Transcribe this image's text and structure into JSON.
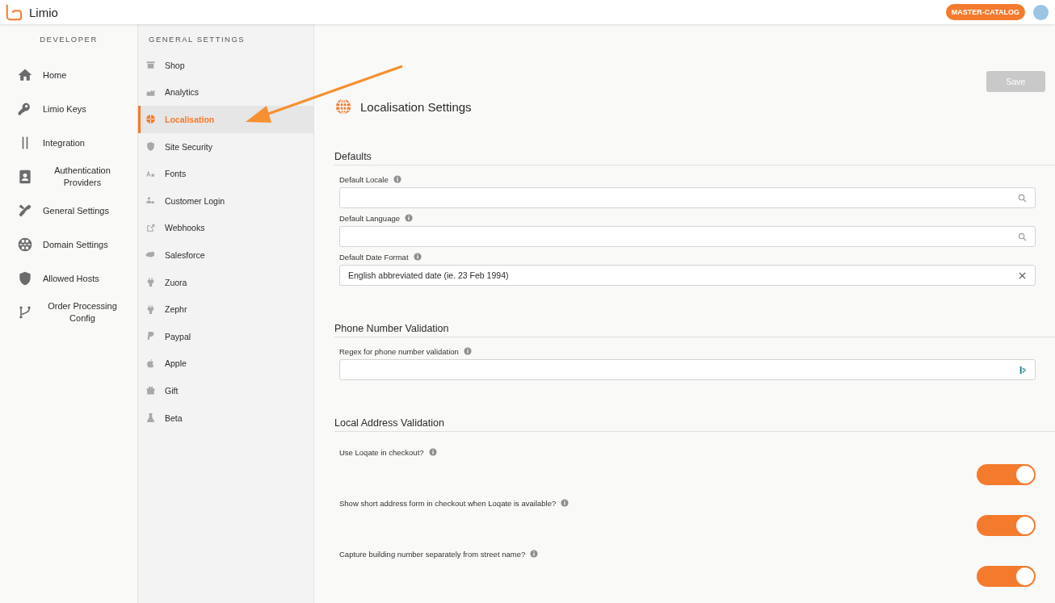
{
  "header": {
    "brand": "Limio",
    "badge": "MASTER-CATALOG"
  },
  "developer_nav": {
    "title": "DEVELOPER",
    "items": [
      {
        "label": "Home"
      },
      {
        "label": "Limio Keys"
      },
      {
        "label": "Integration"
      },
      {
        "label": "Authentication Providers"
      },
      {
        "label": "General Settings"
      },
      {
        "label": "Domain Settings"
      },
      {
        "label": "Allowed Hosts"
      },
      {
        "label": "Order Processing Config"
      }
    ]
  },
  "settings_nav": {
    "title": "GENERAL SETTINGS",
    "items": [
      {
        "label": "Shop",
        "selected": false
      },
      {
        "label": "Analytics",
        "selected": false
      },
      {
        "label": "Localisation",
        "selected": true
      },
      {
        "label": "Site Security",
        "selected": false
      },
      {
        "label": "Fonts",
        "selected": false
      },
      {
        "label": "Customer Login",
        "selected": false
      },
      {
        "label": "Webhooks",
        "selected": false
      },
      {
        "label": "Salesforce",
        "selected": false
      },
      {
        "label": "Zuora",
        "selected": false
      },
      {
        "label": "Zephr",
        "selected": false
      },
      {
        "label": "Paypal",
        "selected": false
      },
      {
        "label": "Apple",
        "selected": false
      },
      {
        "label": "Gift",
        "selected": false
      },
      {
        "label": "Beta",
        "selected": false
      }
    ]
  },
  "save_button": {
    "label": "Save",
    "disabled": true
  },
  "page_title": "Localisation Settings",
  "sections": [
    {
      "title": "Defaults",
      "fields": [
        {
          "kind": "search",
          "label": "Default Locale"
        },
        {
          "kind": "search",
          "label": "Default Language"
        },
        {
          "kind": "clearable",
          "label": "Default Date Format",
          "value": "English abbreviated date (ie. 23 Feb 1994)"
        }
      ]
    },
    {
      "title": "Phone Number Validation",
      "fields": [
        {
          "kind": "text",
          "label": "Regex for phone number validation"
        }
      ]
    },
    {
      "title": "Local Address Validation",
      "fields": [
        {
          "kind": "toggle",
          "label": "Use Loqate in checkout?",
          "on": true
        },
        {
          "kind": "toggle",
          "label": "Show short address form in checkout when Loqate is available?",
          "on": true
        },
        {
          "kind": "toggle",
          "label": "Capture building number separately from street name?",
          "on": true
        }
      ]
    }
  ]
}
